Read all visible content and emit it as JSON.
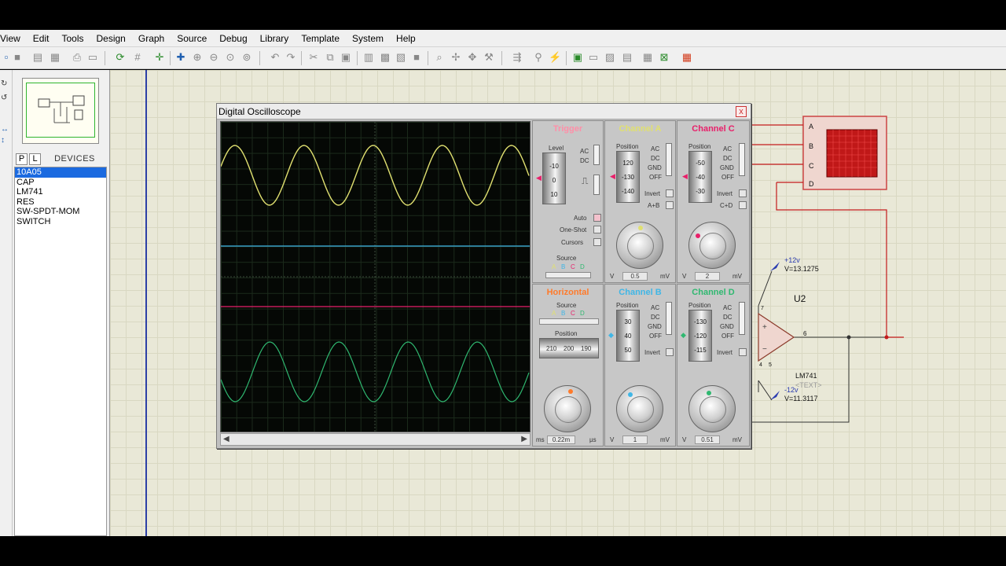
{
  "menu": {
    "items": [
      "View",
      "Edit",
      "Tools",
      "Design",
      "Graph",
      "Source",
      "Debug",
      "Library",
      "Template",
      "System",
      "Help"
    ]
  },
  "devices": {
    "tab_p": "P",
    "tab_l": "L",
    "header": "DEVICES",
    "items": [
      "10A05",
      "CAP",
      "LM741",
      "RES",
      "SW-SPDT-MOM",
      "SWITCH"
    ]
  },
  "oscilloscope": {
    "title": "Digital Oscilloscope",
    "close": "x",
    "trigger": {
      "title": "Trigger",
      "level_label": "Level",
      "level_ticks": [
        "-10",
        "0",
        "10"
      ],
      "ac": "AC",
      "dc": "DC",
      "auto": "Auto",
      "one_shot": "One-Shot",
      "cursors": "Cursors",
      "source_label": "Source",
      "source_letters": [
        "A",
        "B",
        "C",
        "D"
      ]
    },
    "horizontal": {
      "title": "Horizontal",
      "source_label": "Source",
      "source_letters": [
        "A",
        "B",
        "C",
        "D"
      ],
      "position_label": "Position",
      "position_ticks": [
        "210",
        "200",
        "190"
      ],
      "readout": "0.22m",
      "unit_left": "ms",
      "unit_right": "µs"
    },
    "channels": {
      "a": {
        "title": "Channel A",
        "position_label": "Position",
        "ticks": [
          "120",
          "-130",
          "-140"
        ],
        "modes": [
          "AC",
          "DC",
          "GND",
          "OFF"
        ],
        "invert": "Invert",
        "extra": "A+B",
        "readout": "0.5",
        "unit_left": "V",
        "unit_right": "mV"
      },
      "c": {
        "title": "Channel C",
        "position_label": "Position",
        "ticks": [
          "-50",
          "-40",
          "-30"
        ],
        "modes": [
          "AC",
          "DC",
          "GND",
          "OFF"
        ],
        "invert": "Invert",
        "extra": "C+D",
        "readout": "2",
        "unit_left": "V",
        "unit_right": "mV"
      },
      "b": {
        "title": "Channel B",
        "position_label": "Position",
        "ticks": [
          "30",
          "40",
          "50"
        ],
        "modes": [
          "AC",
          "DC",
          "GND",
          "OFF"
        ],
        "invert": "Invert",
        "readout": "1",
        "unit_left": "V",
        "unit_right": "mV"
      },
      "d": {
        "title": "Channel D",
        "position_label": "Position",
        "ticks": [
          "-130",
          "-120",
          "-115"
        ],
        "modes": [
          "AC",
          "DC",
          "GND",
          "OFF"
        ],
        "invert": "Invert",
        "readout": "0.51",
        "unit_left": "V",
        "unit_right": "mV"
      }
    }
  },
  "schematic": {
    "scope_pins": [
      "A",
      "B",
      "C",
      "D"
    ],
    "vplus_label": "+12v",
    "vplus_value": "V=13.1275",
    "opamp_ref": "U2",
    "opamp_part": "LM741",
    "opamp_text": "<TEXT>",
    "vminus_label": "-12v",
    "vminus_value": "V=11.3117",
    "pin_out": "6",
    "pin_top": "7",
    "pin_bottom": "4",
    "pin_bottom2": "5"
  },
  "colors": {
    "channel_a": "#e0e070",
    "channel_b": "#3fb6e6",
    "channel_c": "#e8206a",
    "channel_d": "#2fb870",
    "trigger": "#ff8fa8",
    "horizontal": "#ff7a2a"
  }
}
